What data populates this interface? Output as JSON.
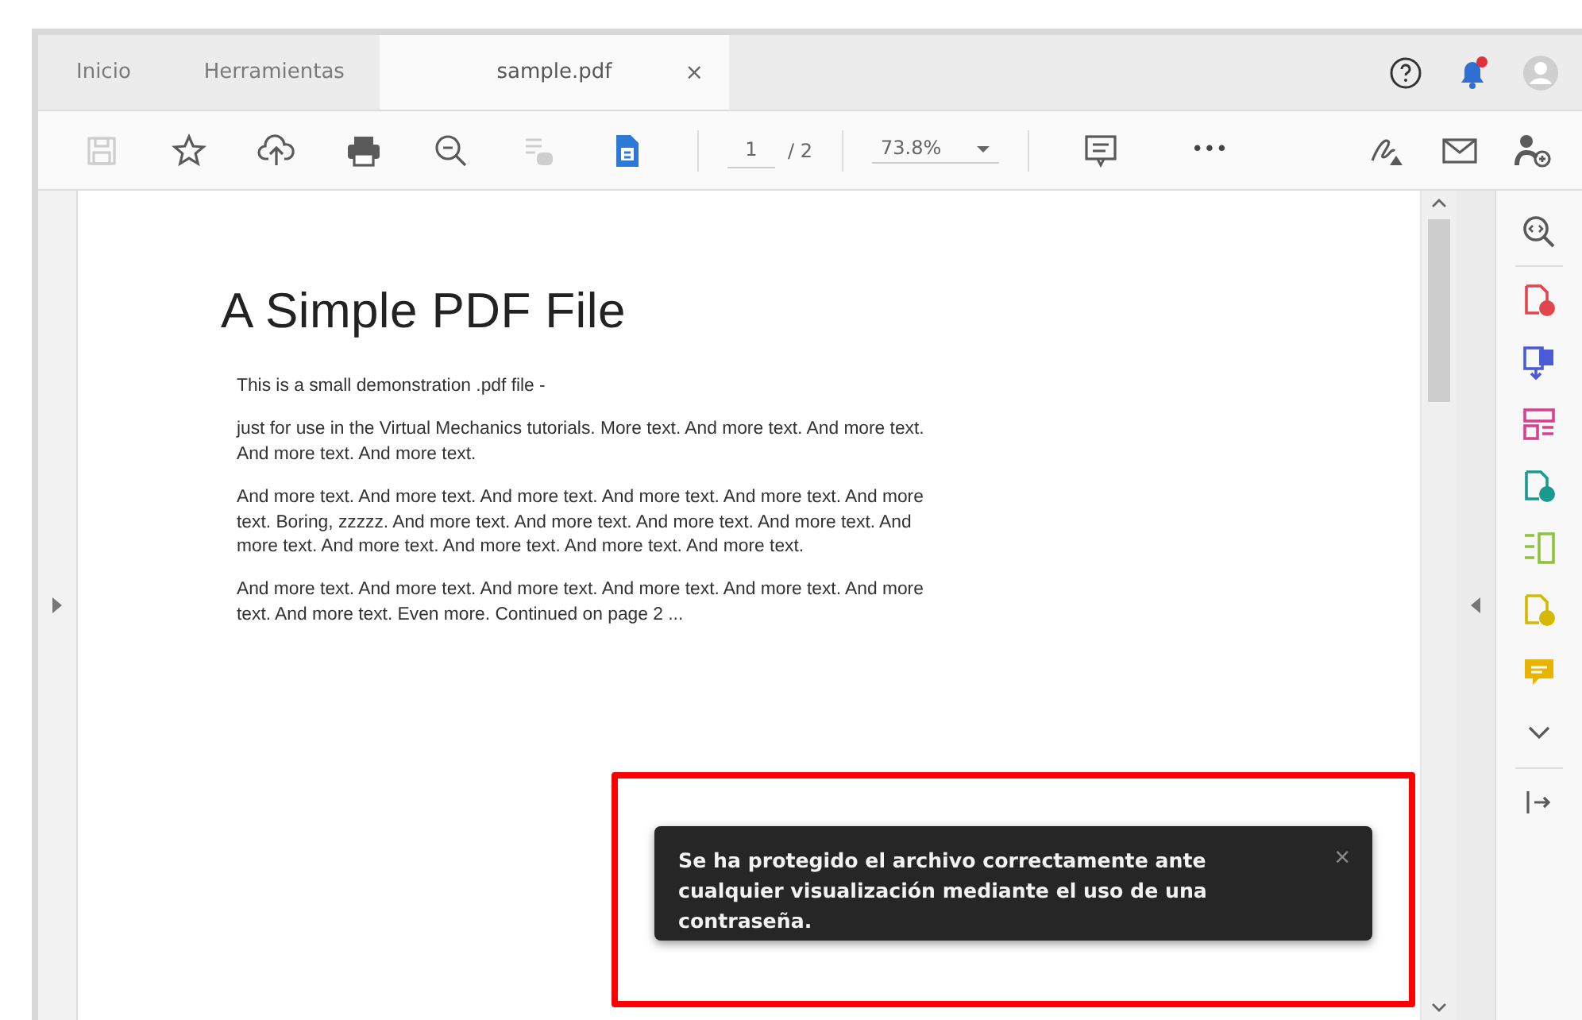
{
  "tabs": [
    {
      "label": "Inicio",
      "selected": false
    },
    {
      "label": "Herramientas",
      "selected": false
    },
    {
      "label": "sample.pdf",
      "selected": true,
      "close": "×"
    }
  ],
  "toolbar": {
    "buttons": [
      {
        "kind": "save",
        "disabled": true
      },
      {
        "kind": "star",
        "disabled": false
      },
      {
        "kind": "upload",
        "disabled": false
      },
      {
        "kind": "print",
        "disabled": false
      },
      {
        "kind": "zoom",
        "disabled": false
      },
      {
        "kind": "redact",
        "disabled": true
      },
      {
        "kind": "pages",
        "disabled": false
      }
    ],
    "page": {
      "current": "1",
      "total": "/ 2"
    },
    "zoom": "73.8%",
    "more": "•••",
    "end_buttons": [
      {
        "kind": "sign",
        "disabled": false
      },
      {
        "kind": "mail",
        "disabled": false
      },
      {
        "kind": "share",
        "disabled": false
      }
    ]
  },
  "document": {
    "title": "A Simple PDF File",
    "paragraphs": [
      "This is a small demonstration .pdf file -",
      "just for use in the Virtual Mechanics tutorials. More text. And more text. And more text. And more text. And more text.",
      "And more text. And more text. And more text. And more text. And more text. And more text. Boring, zzzzz. And more text. And more text. And more text. And more text. And more text. And more text. And more text. And more text. And more text.",
      "And more text. And more text. And more text. And more text. And more text. And more text. And more text. Even more. Continued on page 2 ..."
    ]
  },
  "toast": {
    "message": "Se ha protegido el archivo correctamente ante cualquier visualización mediante el uso de una contraseña.",
    "close": "×"
  },
  "rail": {
    "tools": [
      {
        "kind": "export",
        "color": "#e0464e"
      },
      {
        "kind": "convert",
        "color": "#4a5bd8"
      },
      {
        "kind": "organize",
        "color": "#d8418e"
      },
      {
        "kind": "export",
        "color": "#1a9a8e"
      },
      {
        "kind": "split",
        "color": "#8cc43c"
      },
      {
        "kind": "export",
        "color": "#d6b800"
      },
      {
        "kind": "comment",
        "color": "#e8b400"
      }
    ]
  }
}
